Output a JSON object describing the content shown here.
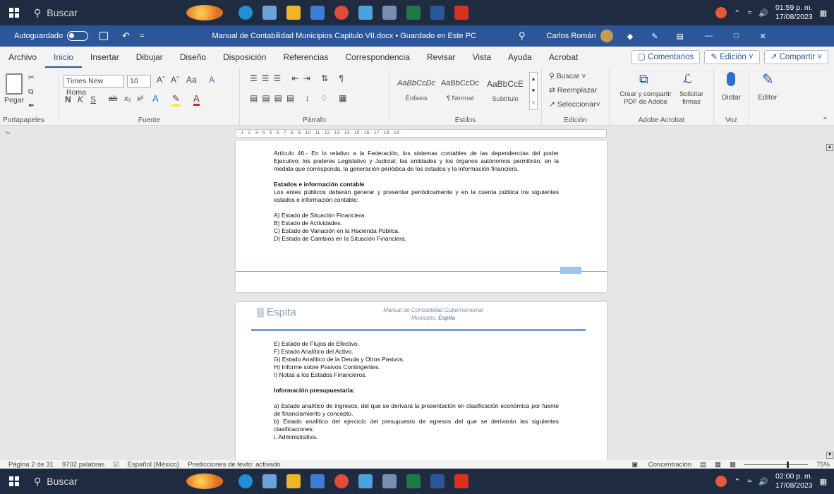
{
  "taskbar": {
    "search_placeholder": "Buscar",
    "time": "01:59 p. m.",
    "date": "17/08/2023"
  },
  "taskbar_bottom": {
    "search_placeholder": "Buscar",
    "time": "02:00 p. m.",
    "date": "17/08/2023"
  },
  "titlebar": {
    "autosave": "Autoguardado",
    "title": "Manual de Contabilidad Municipios Capitulo VII.docx • Guardado en Este PC",
    "user": "Carlos Román"
  },
  "menu": {
    "tabs": [
      "Archivo",
      "Inicio",
      "Insertar",
      "Dibujar",
      "Diseño",
      "Disposición",
      "Referencias",
      "Correspondencia",
      "Revisar",
      "Vista",
      "Ayuda",
      "Acrobat"
    ],
    "comments": "Comentarios",
    "editing": "Edición",
    "share": "Compartir"
  },
  "ribbon": {
    "paste": "Pegar",
    "clipboard": "Portapapeles",
    "font_name": "Times New Roma",
    "font_size": "10",
    "font_group": "Fuente",
    "paragraph_group": "Párrafo",
    "styles": [
      {
        "preview": "AaBbCcDc",
        "name": "Énfasis"
      },
      {
        "preview": "AaBbCcDc",
        "name": "¶ Normal"
      },
      {
        "preview": "AaBbCcE",
        "name": "Subtítulo"
      }
    ],
    "styles_group": "Estilos",
    "find": "Buscar",
    "replace": "Reemplazar",
    "select": "Seleccionar",
    "editing_group": "Edición",
    "create_pdf": "Crear y compartir PDF de Adobe",
    "request_sign": "Solicitar firmas",
    "acrobat_group": "Adobe Acrobat",
    "dictate": "Dictar",
    "voice_group": "Voz",
    "editor": "Editor"
  },
  "page1": {
    "art46": "Artículo 46.- En lo relativo a la Federación, los sistemas contables de las dependencias del poder Ejecutivo; los poderes Legislativo y Judicial; las entidades y los órganos autónomos permitirán, en la medida que corresponda, la generación periódica de los estados y la información financiera.",
    "heading": "Estados e información contable",
    "intro": "Los entes públicos deberán generar y presentar periódicamente y en la cuenta pública los siguientes estados e información contable:",
    "items": [
      "A) Estado de Situación Financiera.",
      "B) Estado de Actividades.",
      "C) Estado de Variación en la Hacienda Pública.",
      "D) Estado de Cambios en la Situación Financiera."
    ]
  },
  "page2": {
    "logo": "Espita",
    "header1": "Manual de Contabilidad Gubernamental",
    "header2_prefix": "Municipio:",
    "header2_name": "Espita",
    "items": [
      "E) Estado de Flujos de Efectivo.",
      "F) Estado Analítico del Activo.",
      "G) Estado Analítico de la Deuda y Otros Pasivos.",
      "H) Informe sobre Pasivos Contingentes.",
      "I) Notas a los Estados Financieros."
    ],
    "heading": "Información presupuestaria:",
    "a": "a) Estado analítico de ingresos, del que se derivará la presentación en clasificación económica por fuente de financiamiento y concepto.",
    "b": "b) Estado analítico del ejercicio del presupuesto de egresos del que se derivarán las siguientes clasificaciones:",
    "i": "i. Administrativa."
  },
  "status": {
    "page": "Página 2 de 31",
    "words": "9702 palabras",
    "lang": "Español (México)",
    "predictions": "Predicciones de texto: activado",
    "focus": "Concentración",
    "zoom": "75%"
  },
  "colors": {
    "accent": "#2b579a",
    "taskbar": "#1f2b40"
  }
}
